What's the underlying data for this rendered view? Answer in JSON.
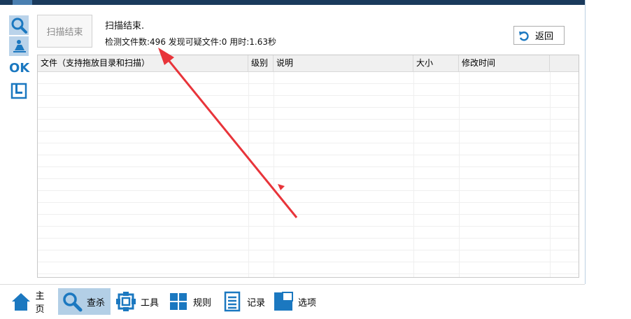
{
  "toolbar": {
    "scan_button_label": "扫描结束",
    "status_main": "扫描结束.",
    "status_detail": "检测文件数:496 发现可疑文件:0 用时:1.63秒",
    "back_label": "返回"
  },
  "side": {
    "ok_label": "OK"
  },
  "table": {
    "columns": [
      "文件（支持拖放目录和扫描）",
      "级别",
      "说明",
      "大小",
      "修改时间"
    ]
  },
  "nav": {
    "items": [
      "主页",
      "查杀",
      "工具",
      "规则",
      "记录",
      "选项"
    ],
    "active": "查杀"
  },
  "colors": {
    "accent": "#1b78c0",
    "active_bg": "#b3cfe6",
    "arrow": "#e8343a"
  }
}
